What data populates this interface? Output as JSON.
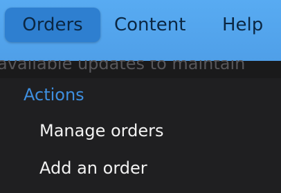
{
  "menubar": {
    "items": [
      {
        "label": "Orders",
        "active": true
      },
      {
        "label": "Content",
        "active": false
      },
      {
        "label": "Help",
        "active": false
      }
    ]
  },
  "background_text": "available updates to maintain",
  "dropdown": {
    "section_heading": "Actions",
    "items": [
      {
        "label": "Manage orders"
      },
      {
        "label": "Add an order"
      }
    ]
  },
  "colors": {
    "menubar": "#53a6ef",
    "active_item": "#2e7fd0",
    "section_heading": "#3e8fe0",
    "dropdown_bg": "#1f1f21"
  }
}
